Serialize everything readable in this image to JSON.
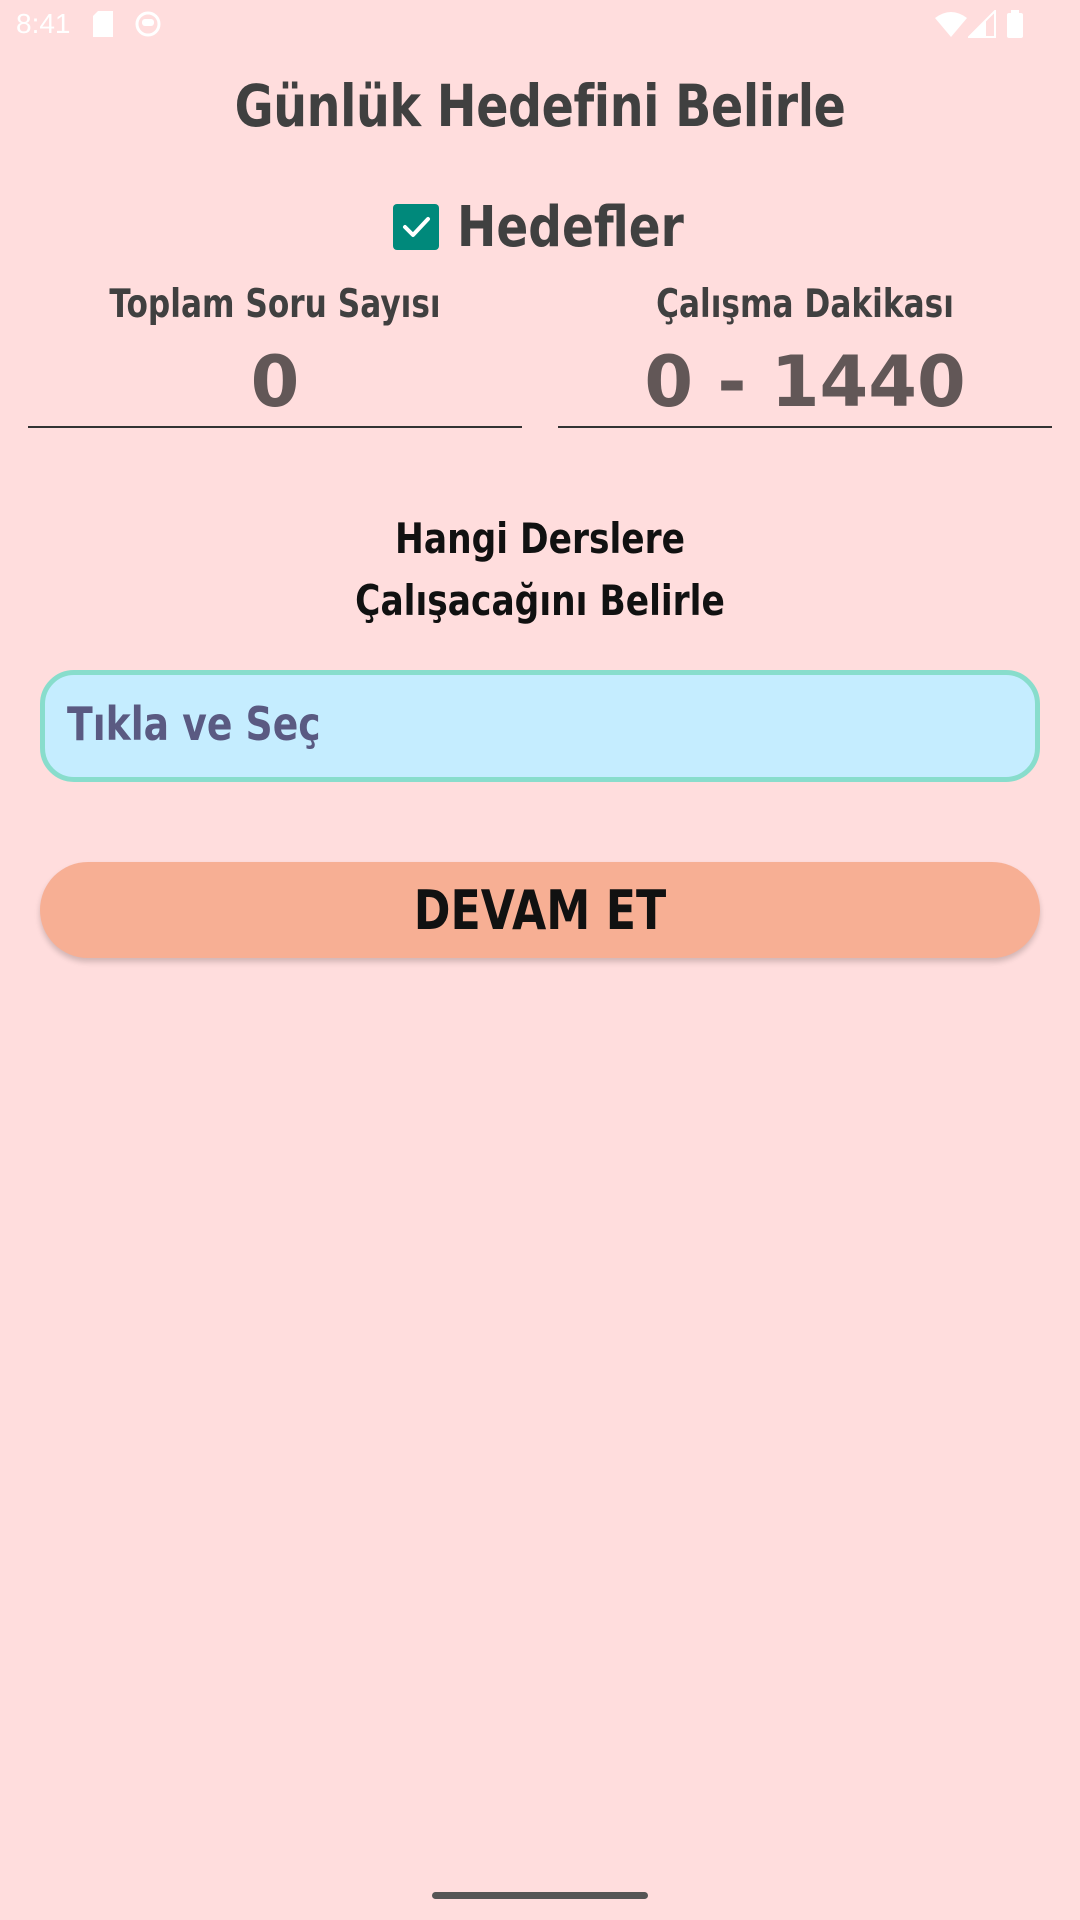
{
  "status_bar": {
    "time": "8:41",
    "icons": [
      "sd-card-icon",
      "notification-icon",
      "wifi-icon",
      "signal-icon",
      "battery-icon"
    ]
  },
  "page": {
    "title": "Günlük Hedefini Belirle",
    "goals": {
      "label": "Hedefler",
      "checked": true,
      "checkbox_color": "#00897b"
    },
    "fields": {
      "question_count": {
        "label": "Toplam Soru Sayısı",
        "placeholder": "0",
        "value": ""
      },
      "study_minutes": {
        "label": "Çalışma Dakikası",
        "placeholder": "0 - 1440",
        "value": ""
      }
    },
    "subtitle": {
      "line1": "Hangi Derslere",
      "line2": "Çalışacağını Belirle"
    },
    "course_select": {
      "text": "Tıkla ve Seç"
    },
    "continue_button": {
      "label": "DEVAM ET"
    }
  },
  "colors": {
    "background": "#ffdddd",
    "select_fill": "#c5edff",
    "select_border": "#88ddcc",
    "button": "#f7af94",
    "accent": "#00897b"
  }
}
